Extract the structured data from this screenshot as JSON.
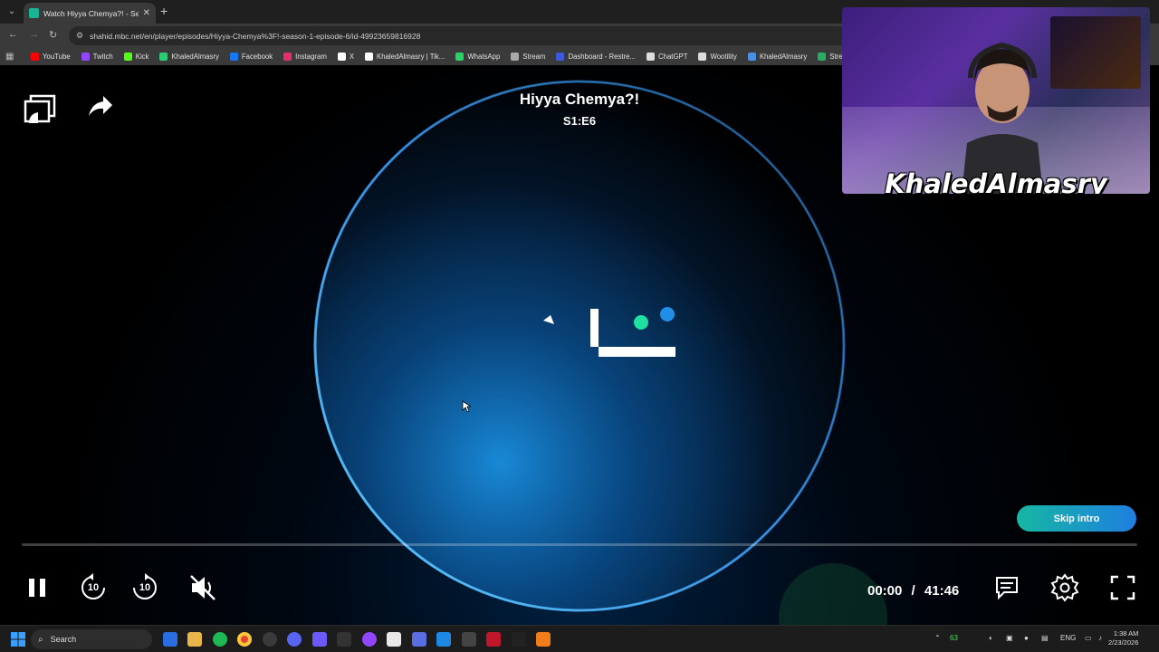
{
  "browser": {
    "tab_title": "Watch Hiyya Chemya?! - Seaso",
    "url": "shahid.mbc.net/en/player/episodes/Hiyya-Chemya%3F!-season-1-episode-6/id-49923659816928",
    "bookmarks": [
      {
        "label": "YouTube",
        "color": "#ff0000"
      },
      {
        "label": "Twitch",
        "color": "#9146ff"
      },
      {
        "label": "Kick",
        "color": "#53fc18"
      },
      {
        "label": "KhaledAlmasry",
        "color": "#2ecc71"
      },
      {
        "label": "Facebook",
        "color": "#1877f2"
      },
      {
        "label": "Instagram",
        "color": "#e1306c"
      },
      {
        "label": "X",
        "color": "#ffffff"
      },
      {
        "label": "KhaledAlmasry | Tik...",
        "color": "#ffffff"
      },
      {
        "label": "WhatsApp",
        "color": "#25d366"
      },
      {
        "label": "Stream",
        "color": "#aaaaaa"
      },
      {
        "label": "Dashboard - Restre...",
        "color": "#3b5bdb"
      },
      {
        "label": "ChatGPT",
        "color": "#dddddd"
      },
      {
        "label": "Wootility",
        "color": "#dddddd"
      },
      {
        "label": "KhaledAlmasry",
        "color": "#4a90e2"
      },
      {
        "label": "StreamCharts",
        "color": "#27ae60"
      }
    ]
  },
  "player": {
    "title": "Hiyya Chemya?!",
    "episode": "S1:E6",
    "skip_intro": "Skip intro",
    "time_current": "00:00",
    "time_separator": "/",
    "time_total": "41:46",
    "progress": 0.0,
    "rewind_seconds": "10",
    "forward_seconds": "10",
    "accent_color": "#1ab394"
  },
  "webcam": {
    "name": "KhaledAlmasry"
  },
  "taskbar": {
    "search_label": "Search",
    "tray_temp": "63",
    "language": "ENG",
    "time": "1:38 AM",
    "date": "2/23/2026"
  }
}
